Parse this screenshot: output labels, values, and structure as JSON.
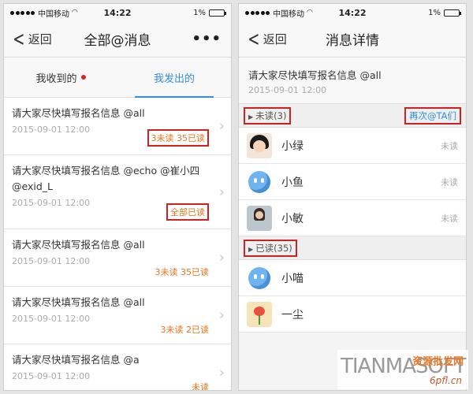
{
  "status_bar": {
    "carrier": "中国移动",
    "time": "14:22",
    "battery": "1%"
  },
  "left_screen": {
    "back_label": "返回",
    "title": "全部@消息",
    "more_label": "•••",
    "tabs": [
      {
        "label": "我收到的",
        "active": false,
        "has_dot": true
      },
      {
        "label": "我发出的",
        "active": true
      }
    ],
    "messages": [
      {
        "text": "请大家尽快填写报名信息  @all",
        "date": "2015-09-01 12:00",
        "status": "3未读  35已读",
        "highlighted": true
      },
      {
        "text": "请大家尽快填写报名信息  @echo  @崔小四  @exid_L",
        "date": "2015-09-01 12:00",
        "status": "全部已读",
        "highlighted": true
      },
      {
        "text": "请大家尽快填写报名信息  @all",
        "date": "2015-09-01 12:00",
        "status": "3未读  35已读",
        "highlighted": false
      },
      {
        "text": "请大家尽快填写报名信息  @all",
        "date": "2015-09-01 12:00",
        "status": "3未读  2已读",
        "highlighted": false
      },
      {
        "text": "请大家尽快填写报名信息  @a",
        "date": "2015-09-01 12:00",
        "status": "未读",
        "highlighted": false
      }
    ]
  },
  "right_screen": {
    "back_label": "返回",
    "title": "消息详情",
    "message_text": "请大家尽快填写报名信息  @all",
    "message_date": "2015-09-01 12:00",
    "unread_section": {
      "label": "未读(3)",
      "remind_button": "再次@TA们",
      "people": [
        {
          "name": "小绿",
          "status": "未读",
          "avatar": "girl-cartoon-icon"
        },
        {
          "name": "小鱼",
          "status": "未读",
          "avatar": "blue-blob-icon"
        },
        {
          "name": "小敏",
          "status": "未读",
          "avatar": "photo-avatar"
        }
      ]
    },
    "read_section": {
      "label": "已读(35)",
      "people": [
        {
          "name": "小喵",
          "avatar": "blue-blob-icon"
        },
        {
          "name": "一尘",
          "avatar": "flower-icon"
        }
      ]
    }
  },
  "watermark": {
    "latin": "TIANMASOFT",
    "cn": "资源批发网",
    "url": "6pfl.cn"
  },
  "colors": {
    "accent_blue": "#2f8fe0",
    "highlight_red": "#cc2222",
    "status_orange": "#e8741c"
  }
}
